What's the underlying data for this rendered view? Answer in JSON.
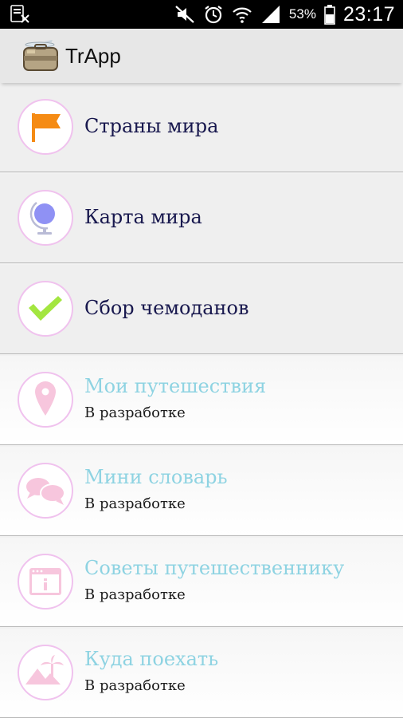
{
  "status_bar": {
    "battery_percent": "53%",
    "time": "23:17"
  },
  "app_bar": {
    "title": "TrApp"
  },
  "menu": {
    "items": [
      {
        "title": "Страны мира",
        "icon": "flag-icon",
        "enabled": true
      },
      {
        "title": "Карта мира",
        "icon": "globe-icon",
        "enabled": true
      },
      {
        "title": "Сбор чемоданов",
        "icon": "checkmark-icon",
        "enabled": true
      },
      {
        "title": "Мои путешествия",
        "subtitle": "В разработке",
        "icon": "map-pin-icon",
        "enabled": false
      },
      {
        "title": "Мини словарь",
        "subtitle": "В разработке",
        "icon": "chat-bubbles-icon",
        "enabled": false
      },
      {
        "title": "Советы путешественнику",
        "subtitle": "В разработке",
        "icon": "info-window-icon",
        "enabled": false
      },
      {
        "title": "Куда поехать",
        "subtitle": "В разработке",
        "icon": "desert-palm-icon",
        "enabled": false
      }
    ]
  },
  "colors": {
    "enabled_title": "#18184e",
    "disabled_title": "#8ed3e2",
    "icon_ring": "#f0c2ee",
    "disabled_icon": "#f7c6dd"
  }
}
